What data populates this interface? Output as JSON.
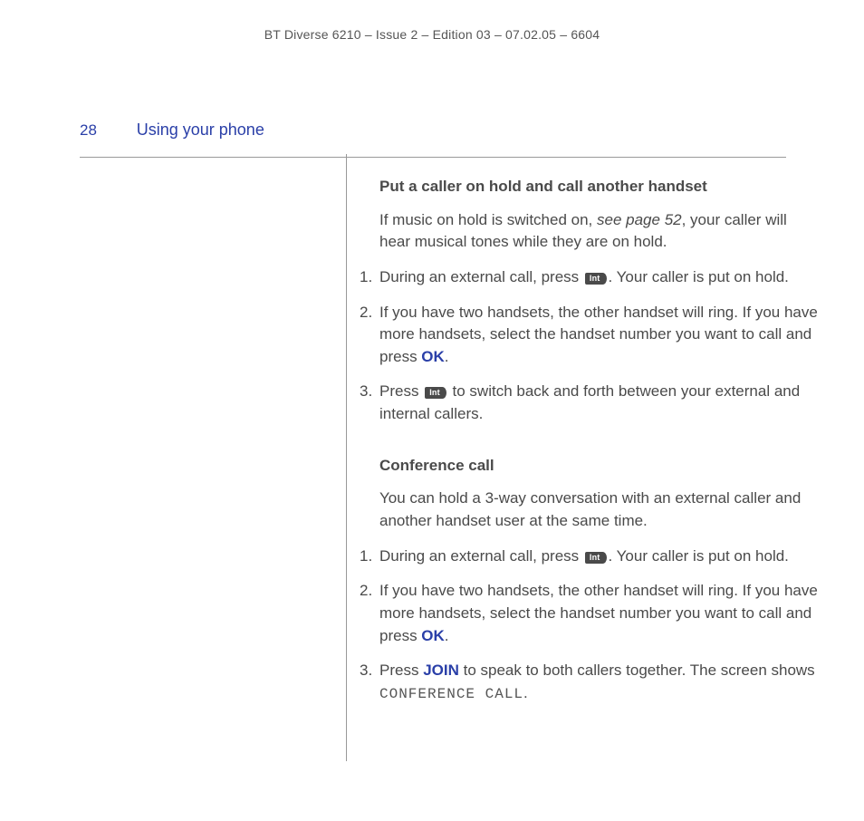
{
  "running_head": "BT Diverse 6210 – Issue 2 – Edition 03 – 07.02.05 – 6604",
  "page_number": "28",
  "section_title": "Using your phone",
  "key_label": "Int",
  "sections": [
    {
      "heading": "Put a caller on hold and call another handset",
      "intro_pre": "If music on hold is switched on, ",
      "intro_ref": "see page 52",
      "intro_post": ", your caller will hear musical tones while they are on hold.",
      "steps": [
        {
          "pre": "During an external call, press ",
          "post": ". Your caller is put on hold.",
          "has_key": true
        },
        {
          "pre": "If you have two handsets, the other handset will ring. If you have more handsets, select the handset number you want to call and press ",
          "ok": "OK",
          "post": ".",
          "has_key": false
        },
        {
          "pre": "Press ",
          "post": " to switch back and forth between your external and internal callers.",
          "has_key": true
        }
      ]
    },
    {
      "heading": "Conference call",
      "intro": "You can hold a 3-way conversation with an external caller and another handset user at the same time.",
      "steps": [
        {
          "pre": "During an external call, press ",
          "post": ". Your caller is put on hold.",
          "has_key": true
        },
        {
          "pre": "If you have two handsets, the other handset will ring. If you have more handsets, select the handset number you want to call and press ",
          "ok": "OK",
          "post": ".",
          "has_key": false
        },
        {
          "pre": "Press ",
          "join": "JOIN",
          "mid": " to speak to both callers together. The screen shows ",
          "lcd": "CONFERENCE CALL",
          "post": ".",
          "has_key": false
        }
      ]
    }
  ]
}
